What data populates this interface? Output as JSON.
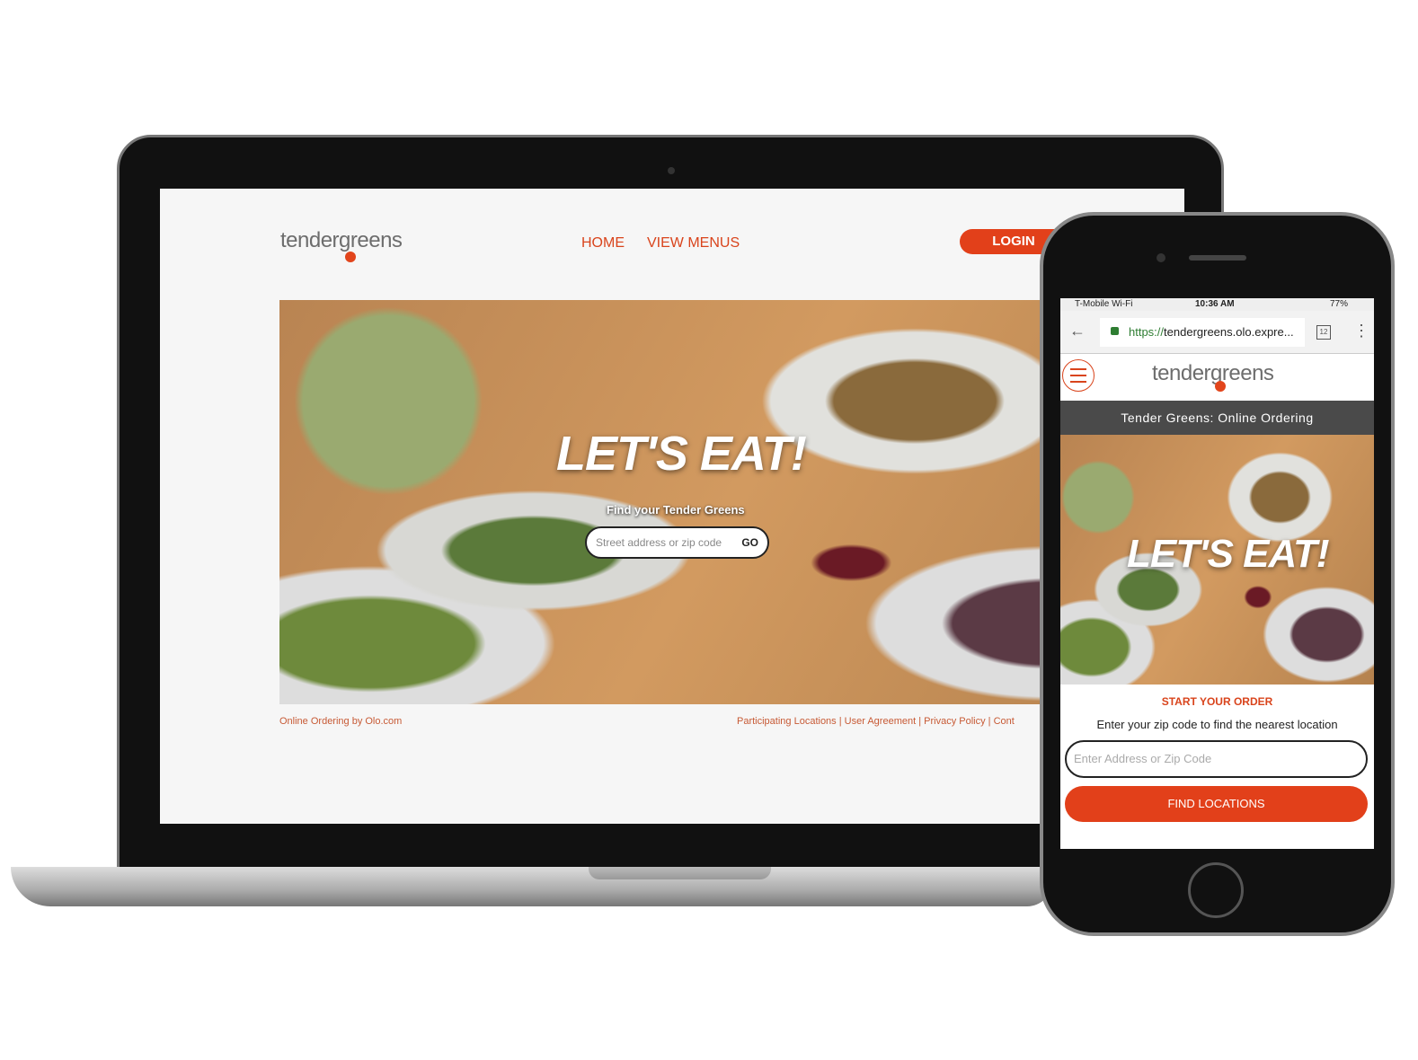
{
  "desktop": {
    "logo": "tendergreens",
    "nav": [
      "HOME",
      "VIEW MENUS"
    ],
    "login": "LOGIN",
    "hero_title": "LET'S EAT!",
    "hero_subtitle": "Find your Tender Greens",
    "search_placeholder": "Street address or zip code",
    "go": "GO",
    "footer_left": "Online Ordering by Olo.com",
    "footer_links": [
      "Participating Locations",
      "User Agreement",
      "Privacy Policy",
      "Cont"
    ]
  },
  "mobile": {
    "carrier": "T-Mobile Wi-Fi",
    "time": "10:36 AM",
    "battery": "77%",
    "url_scheme": "https://",
    "url_rest": "tendergreens.olo.expre...",
    "tabs_count": "12",
    "logo": "tendergreens",
    "banner": "Tender Greens: Online Ordering",
    "hero_title": "LET'S EAT!",
    "order_heading": "START YOUR ORDER",
    "order_text": "Enter your zip code to find the nearest location",
    "input_placeholder": "Enter Address or Zip Code",
    "find_button": "FIND LOCATIONS"
  },
  "colors": {
    "accent": "#e2401a"
  }
}
